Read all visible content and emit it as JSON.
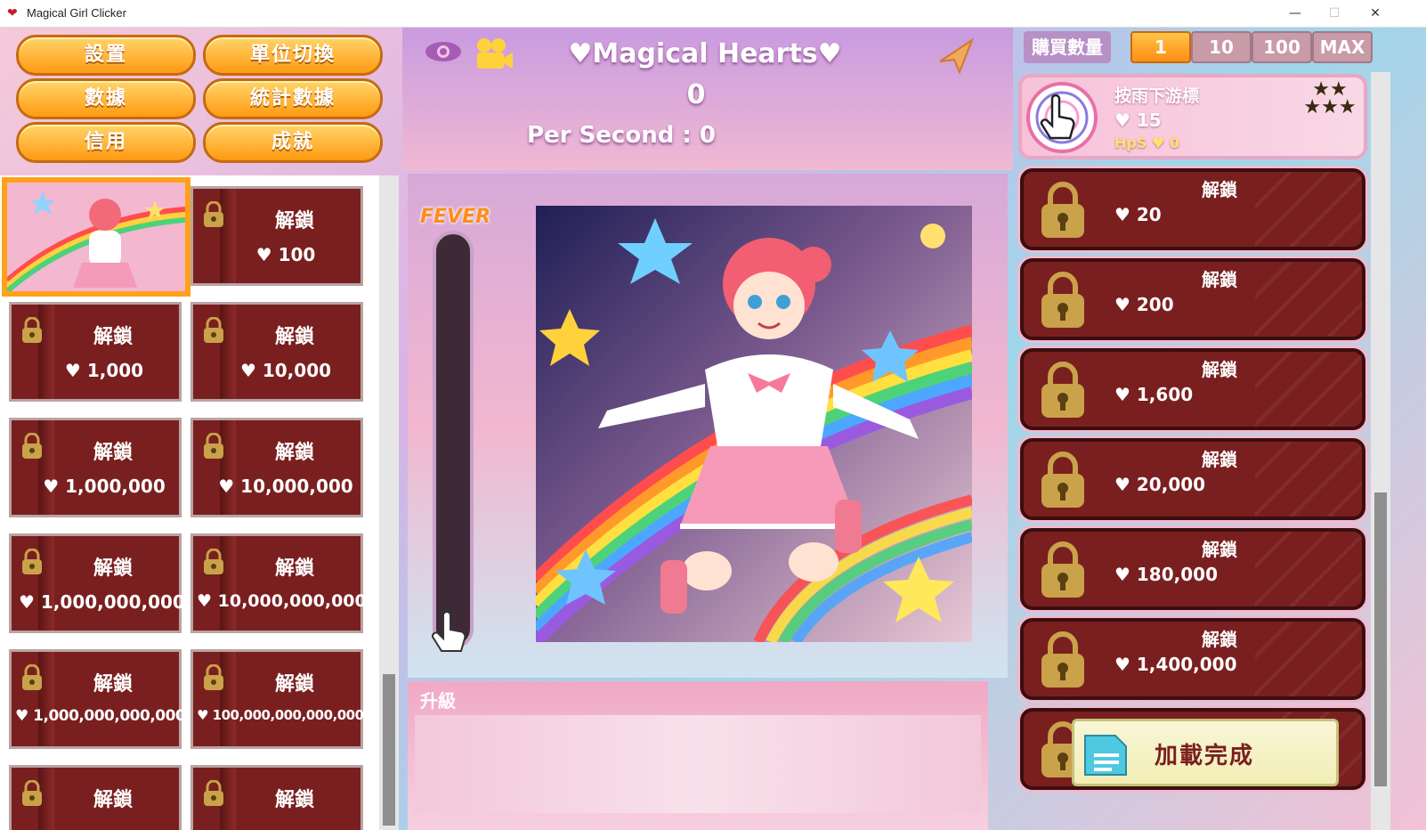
{
  "window": {
    "title": "Magical Girl Clicker",
    "controls": {
      "minimize": "—",
      "maximize": "☐",
      "close": "✕"
    }
  },
  "menu": {
    "settings": "設置",
    "unit_switch": "單位切換",
    "data": "數據",
    "statistics": "統計數據",
    "credits": "信用",
    "achievements": "成就"
  },
  "left_cards": [
    {
      "label": "解鎖",
      "price": "♥ 100"
    },
    {
      "label": "解鎖",
      "price": "♥ 1,000"
    },
    {
      "label": "解鎖",
      "price": "♥ 10,000"
    },
    {
      "label": "解鎖",
      "price": "♥ 1,000,000"
    },
    {
      "label": "解鎖",
      "price": "♥ 10,000,000"
    },
    {
      "label": "解鎖",
      "price": "♥ 1,000,000,000"
    },
    {
      "label": "解鎖",
      "price": "♥ 10,000,000,000"
    },
    {
      "label": "解鎖",
      "price": "♥ 1,000,000,000,000"
    },
    {
      "label": "解鎖",
      "price": "♥ 100,000,000,000,000"
    },
    {
      "label": "解鎖",
      "price": ""
    },
    {
      "label": "解鎖",
      "price": ""
    }
  ],
  "center": {
    "title": "♥Magical Hearts♥",
    "hearts": "0",
    "per_second": "Per Second : 0",
    "fever_label": "FEVER",
    "fever_level": 0,
    "upgrade_title": "升級"
  },
  "purchase": {
    "label": "購買數量",
    "options": [
      "1",
      "10",
      "100",
      "MAX"
    ],
    "selected": "1"
  },
  "cursor_item": {
    "name": "按雨下游標",
    "cost": "♥ 15",
    "hps": "HpS ♥ 0",
    "stars": "★★ ★★★"
  },
  "buildings": [
    {
      "label": "解鎖",
      "price": "♥ 20"
    },
    {
      "label": "解鎖",
      "price": "♥ 200"
    },
    {
      "label": "解鎖",
      "price": "♥ 1,600"
    },
    {
      "label": "解鎖",
      "price": "♥ 20,000"
    },
    {
      "label": "解鎖",
      "price": "♥ 180,000"
    },
    {
      "label": "解鎖",
      "price": "♥ 1,400,000"
    },
    {
      "label": "解鎖",
      "price": ""
    }
  ],
  "toast": {
    "message": "加載完成"
  },
  "colors": {
    "accent_orange": "#ff9a12",
    "card_maroon": "#7a1f1f",
    "fever_orange": "#ff8c1a"
  }
}
